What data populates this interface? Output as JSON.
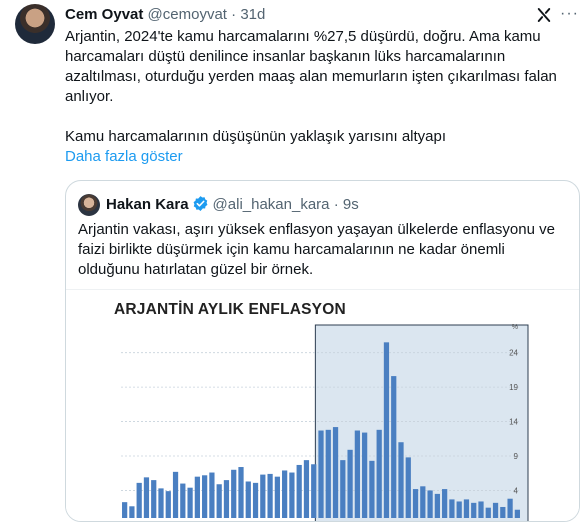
{
  "tweet": {
    "author_name": "Cem Oyvat",
    "handle": "@cemoyvat",
    "separator": "·",
    "time": "31d",
    "text_line1": "Arjantin, 2024'te kamu harcamalarını %27,5 düşürdü, doğru. Ama kamu harcamaları düştü denilince insanlar başkanın lüks harcamalarının azaltılması, oturduğu yerden maaş alan memurların işten çıkarılması falan anlıyor.",
    "text_line2": "Kamu harcamalarının düşüşünün yaklaşık yarısını altyapı",
    "show_more": "Daha fazla göster",
    "icons": {
      "grok": "grok-icon",
      "more": "more-options-icon",
      "avatar": "avatar"
    }
  },
  "quoted": {
    "author_name": "Hakan Kara",
    "handle": "@ali_hakan_kara",
    "separator": "·",
    "time": "9s",
    "verified_color": "#1d9bf0",
    "text": "Arjantin vakası, aşırı yüksek enflasyon yaşayan ülkelerde enflasyonu ve faizi birlikte düşürmek için kamu harcamalarının ne kadar önemli olduğunu hatırlatan güzel bir örnek."
  },
  "chart_data": {
    "type": "bar",
    "title": "ARJANTİN AYLIK ENFLASYON",
    "ylabel": "%",
    "ylim": [
      0,
      27
    ],
    "y_ticks": [
      4,
      9,
      14,
      19,
      24
    ],
    "bar_color": "#4a7fc1",
    "highlight_color": "#dbe6f0",
    "highlight_border": "#2d3e50",
    "highlight_from_index": 27,
    "values": [
      2.3,
      1.7,
      5.1,
      5.9,
      5.5,
      4.3,
      3.9,
      6.7,
      5.0,
      4.4,
      6.0,
      6.2,
      6.6,
      4.9,
      5.5,
      7.0,
      7.4,
      5.3,
      5.1,
      6.3,
      6.4,
      6.0,
      6.9,
      6.6,
      7.7,
      8.4,
      7.8,
      12.7,
      12.8,
      13.2,
      8.4,
      9.9,
      12.7,
      12.4,
      8.3,
      12.8,
      25.5,
      20.6,
      11.0,
      8.8,
      4.2,
      4.6,
      4.0,
      3.5,
      4.2,
      2.7,
      2.4,
      2.7,
      2.2,
      2.4,
      1.5,
      2.2,
      1.6,
      2.8,
      1.2
    ]
  }
}
